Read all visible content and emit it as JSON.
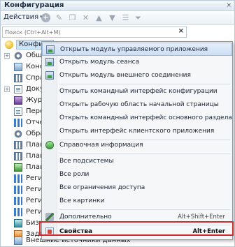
{
  "window": {
    "title": "Конфигурация",
    "close_glyph": "×"
  },
  "toolbar": {
    "actions_label": "Действия",
    "icons": [
      "add-icon",
      "edit-icon",
      "copy-icon",
      "delete-icon",
      "move-up-icon",
      "move-down-icon",
      "list-icon",
      "filter-icon"
    ]
  },
  "search": {
    "placeholder": "Поиск (Ctrl+Alt+M)",
    "clear_glyph": "×"
  },
  "tree": {
    "root_label": "Конфигу",
    "items": [
      {
        "label": "Общ",
        "expandable": true
      },
      {
        "label": "Конс",
        "expandable": false
      },
      {
        "label": "Спра",
        "expandable": false
      },
      {
        "label": "Доку",
        "expandable": true
      },
      {
        "label": "Жур",
        "expandable": false
      },
      {
        "label": "Пере",
        "expandable": false
      },
      {
        "label": "Отче",
        "expandable": false
      },
      {
        "label": "Обра",
        "expandable": false
      },
      {
        "label": "План",
        "expandable": false
      },
      {
        "label": "План",
        "expandable": false
      },
      {
        "label": "План",
        "expandable": false
      },
      {
        "label": "Реги",
        "expandable": false
      },
      {
        "label": "Реги",
        "expandable": false
      },
      {
        "label": "Реги",
        "expandable": false
      },
      {
        "label": "Реги",
        "expandable": false
      },
      {
        "label": "Бизн",
        "expandable": false
      },
      {
        "label": "Зада",
        "expandable": false
      }
    ],
    "bottom_label": "Внешние источники данных"
  },
  "context_menu": {
    "items": [
      {
        "label": "Открыть модуль управляемого приложения",
        "icon": "module-icon",
        "shortcut": ""
      },
      {
        "label": "Открыть модуль сеанса",
        "icon": "module-icon",
        "shortcut": ""
      },
      {
        "label": "Открыть модуль внешнего соединения",
        "icon": "module-icon",
        "shortcut": ""
      },
      {
        "label": "Открыть командный интерфейс конфигурации",
        "icon": "",
        "shortcut": ""
      },
      {
        "label": "Открыть рабочую область начальной страницы",
        "icon": "",
        "shortcut": ""
      },
      {
        "label": "Открыть командный интерфейс основного раздела",
        "icon": "",
        "shortcut": ""
      },
      {
        "label": "Открыть интерфейс клиентского приложения",
        "icon": "",
        "shortcut": ""
      },
      {
        "label": "Справочная информация",
        "icon": "help-info-icon",
        "shortcut": ""
      },
      {
        "label": "Все подсистемы",
        "icon": "",
        "shortcut": ""
      },
      {
        "label": "Все роли",
        "icon": "",
        "shortcut": ""
      },
      {
        "label": "Все ограничения доступа",
        "icon": "",
        "shortcut": ""
      },
      {
        "label": "Все картинки",
        "icon": "",
        "shortcut": ""
      },
      {
        "label": "Дополнительно",
        "icon": "tools-icon",
        "shortcut": "Alt+Shift+Enter"
      },
      {
        "label": "Свойства",
        "icon": "properties-icon",
        "shortcut": "Alt+Enter"
      }
    ]
  },
  "colors": {
    "highlight_bg": "#cddff5",
    "highlight_border": "#97b9e2",
    "red_frame": "#d32a2a",
    "title_text": "#1d2e44"
  }
}
